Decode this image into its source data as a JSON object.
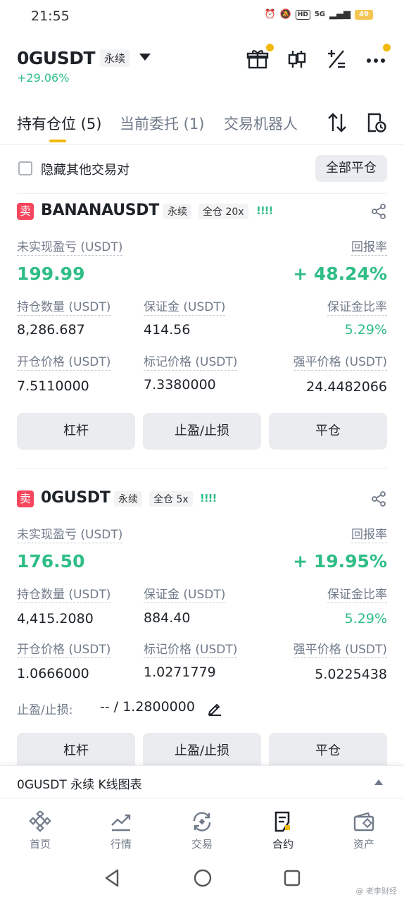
{
  "status_bar": {
    "time": "21:55",
    "signal": "5G",
    "battery": "49"
  },
  "header": {
    "symbol": "0GUSDT",
    "contract_type": "永续",
    "change": "+29.06%"
  },
  "tabs": [
    {
      "label": "持有仓位 (5)"
    },
    {
      "label": "当前委托 (1)"
    },
    {
      "label": "交易机器人"
    }
  ],
  "filter": {
    "hide_label": "隐藏其他交易对",
    "close_all_label": "全部平仓"
  },
  "labels": {
    "unrealized_pnl": "未实现盈亏 (USDT)",
    "roi": "回报率",
    "size": "持仓数量 (USDT)",
    "margin": "保证金 (USDT)",
    "margin_ratio": "保证金比率",
    "entry_price": "开仓价格 (USDT)",
    "mark_price": "标记价格 (USDT)",
    "liq_price": "强平价格 (USDT)",
    "leverage_btn": "杠杆",
    "tpsl_btn": "止盈/止损",
    "close_btn": "平仓",
    "tpsl_label": "止盈/止损:"
  },
  "positions": [
    {
      "side": "卖",
      "symbol": "BANANAUSDT",
      "contract_type": "永续",
      "margin_mode": "全仓 20x",
      "pnl": "199.99",
      "roi": "+ 48.24%",
      "size": "8,286.687",
      "margin": "414.56",
      "margin_ratio": "5.29%",
      "entry_price": "7.5110000",
      "mark_price": "7.3380000",
      "liq_price": "24.4482066"
    },
    {
      "side": "卖",
      "symbol": "0GUSDT",
      "contract_type": "永续",
      "margin_mode": "全仓 5x",
      "pnl": "176.50",
      "roi": "+ 19.95%",
      "size": "4,415.2080",
      "margin": "884.40",
      "margin_ratio": "5.29%",
      "entry_price": "1.0666000",
      "mark_price": "1.0271779",
      "liq_price": "5.0225438",
      "tpsl": "-- / 1.2800000"
    }
  ],
  "kline_bar": {
    "label": "0GUSDT 永续 K线图表"
  },
  "bottom_nav": [
    {
      "label": "首页",
      "icon": "home-icon"
    },
    {
      "label": "行情",
      "icon": "markets-icon"
    },
    {
      "label": "交易",
      "icon": "trade-icon"
    },
    {
      "label": "合约",
      "icon": "futures-icon",
      "active": true
    },
    {
      "label": "资产",
      "icon": "wallet-icon"
    }
  ],
  "watermark": "@ 老李财经",
  "colors": {
    "accent": "#f0b90b",
    "positive": "#2ebd85",
    "sell": "#f6465d"
  }
}
